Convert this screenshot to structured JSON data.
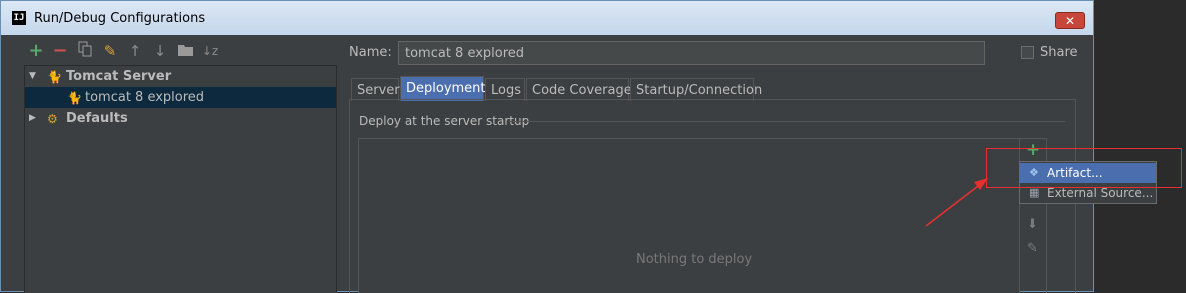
{
  "window": {
    "title": "Run/Debug Configurations",
    "app_icon_text": "IJ",
    "close_label": "✕"
  },
  "toolbar": {
    "buttons": [
      "add-icon",
      "remove-icon",
      "copy-icon",
      "edit-defaults-icon",
      "move-up-icon",
      "move-down-icon",
      "folder-icon",
      "sort-icon"
    ]
  },
  "tree": {
    "items": [
      {
        "label": "Tomcat Server",
        "expanded": true,
        "bold": true,
        "icon": "tomcat-icon"
      },
      {
        "label": "tomcat 8 explored",
        "selected": true,
        "icon": "tomcat-icon"
      },
      {
        "label": "Defaults",
        "expanded": false,
        "bold": true,
        "icon": "defaults-icon"
      }
    ]
  },
  "name_field": {
    "label": "Name:",
    "value": "tomcat 8 explored"
  },
  "share": {
    "label": "Share",
    "checked": false
  },
  "tabs": [
    {
      "label": "Server"
    },
    {
      "label": "Deployment",
      "active": true
    },
    {
      "label": "Logs"
    },
    {
      "label": "Code Coverage"
    },
    {
      "label": "Startup/Connection"
    }
  ],
  "deployment": {
    "section_label": "Deploy at the server startup",
    "empty_text": "Nothing to deploy"
  },
  "popup": {
    "items": [
      {
        "label": "Artifact...",
        "selected": true,
        "icon": "artifact-icon"
      },
      {
        "label": "External Source...",
        "icon": "external-source-icon"
      }
    ]
  },
  "colors": {
    "accent": "#4b6eaf",
    "annotation": "#e53030",
    "add_green": "#59a869"
  }
}
